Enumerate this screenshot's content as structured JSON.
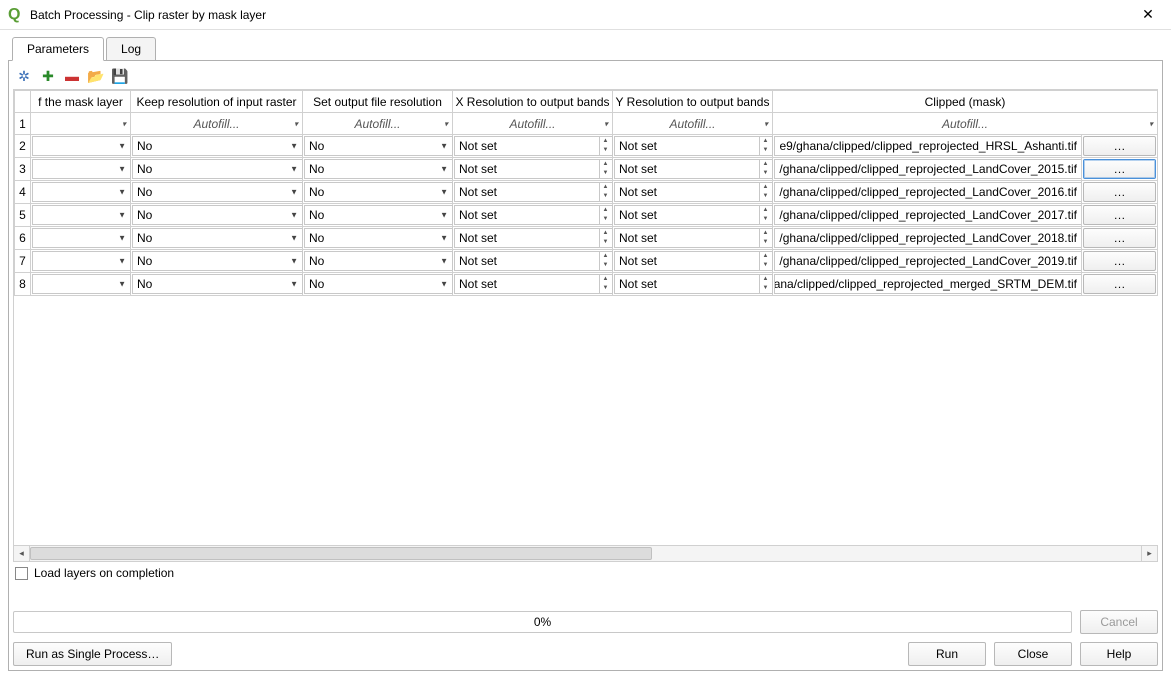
{
  "window": {
    "title": "Batch Processing - Clip raster by mask layer"
  },
  "tabs": {
    "parameters": "Parameters",
    "log": "Log"
  },
  "columns": {
    "mask": "f the mask layer",
    "keep": "Keep resolution of input raster",
    "setres": "Set output file resolution",
    "xres": "X Resolution to output bands",
    "yres": "Y Resolution to output bands",
    "clipped": "Clipped (mask)"
  },
  "autofill": "Autofill...",
  "rows": [
    {
      "n": "2",
      "mask": "",
      "keep": "No",
      "setres": "No",
      "xres": "Not set",
      "yres": "Not set",
      "clipped": "e9/ghana/clipped/clipped_reprojected_HRSL_Ashanti.tif",
      "sel": false
    },
    {
      "n": "3",
      "mask": "",
      "keep": "No",
      "setres": "No",
      "xres": "Not set",
      "yres": "Not set",
      "clipped": "/ghana/clipped/clipped_reprojected_LandCover_2015.tif",
      "sel": true
    },
    {
      "n": "4",
      "mask": "",
      "keep": "No",
      "setres": "No",
      "xres": "Not set",
      "yres": "Not set",
      "clipped": "/ghana/clipped/clipped_reprojected_LandCover_2016.tif",
      "sel": false
    },
    {
      "n": "5",
      "mask": "",
      "keep": "No",
      "setres": "No",
      "xres": "Not set",
      "yres": "Not set",
      "clipped": "/ghana/clipped/clipped_reprojected_LandCover_2017.tif",
      "sel": false
    },
    {
      "n": "6",
      "mask": "",
      "keep": "No",
      "setres": "No",
      "xres": "Not set",
      "yres": "Not set",
      "clipped": "/ghana/clipped/clipped_reprojected_LandCover_2018.tif",
      "sel": false
    },
    {
      "n": "7",
      "mask": "",
      "keep": "No",
      "setres": "No",
      "xres": "Not set",
      "yres": "Not set",
      "clipped": "/ghana/clipped/clipped_reprojected_LandCover_2019.tif",
      "sel": false
    },
    {
      "n": "8",
      "mask": "",
      "keep": "No",
      "setres": "No",
      "xres": "Not set",
      "yres": "Not set",
      "clipped": "ana/clipped/clipped_reprojected_merged_SRTM_DEM.tif",
      "sel": false
    }
  ],
  "row1": "1",
  "check": {
    "label": "Load layers on completion"
  },
  "progress": "0%",
  "buttons": {
    "cancel": "Cancel",
    "single": "Run as Single Process…",
    "run": "Run",
    "close": "Close",
    "help": "Help",
    "browse": "…"
  }
}
